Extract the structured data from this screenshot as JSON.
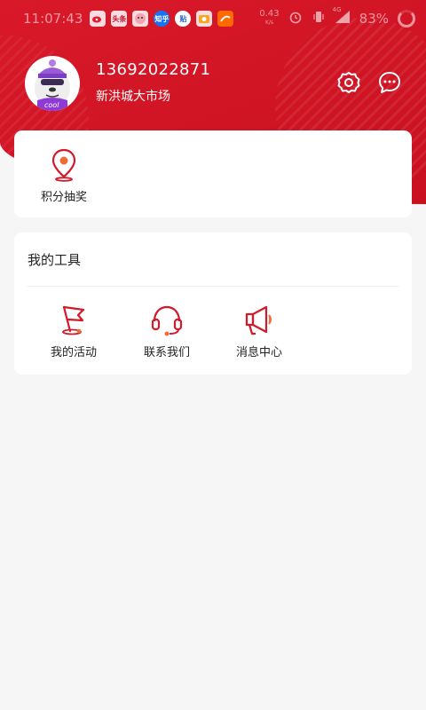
{
  "status_bar": {
    "time": "11:07:43",
    "apps": [
      "weibo-app",
      "toutiao-app",
      "comic-app",
      "zhihu-app",
      "tieba-app",
      "video-app",
      "store-app"
    ],
    "app_labels": [
      "",
      "头条",
      "",
      "知乎",
      "贴",
      "",
      ""
    ],
    "network_speed": "0.43",
    "network_unit": "K/s",
    "signal_label": "4G",
    "battery_percent": "83%"
  },
  "profile": {
    "avatar_label": "cool",
    "phone": "13692022871",
    "market_name": "新洪城大市场"
  },
  "header_actions": {
    "settings_icon": "gear-icon",
    "message_icon": "chat-bubble-icon"
  },
  "lottery_card": {
    "label": "积分抽奖",
    "icon": "location-pin-icon"
  },
  "tools": {
    "title": "我的工具",
    "items": [
      {
        "label": "我的活动",
        "icon": "flag-icon"
      },
      {
        "label": "联系我们",
        "icon": "headset-icon"
      },
      {
        "label": "消息中心",
        "icon": "megaphone-icon"
      }
    ]
  },
  "colors": {
    "primary_red": "#d11a2a",
    "accent_orange": "#f06a3a",
    "background": "#f6f6f6"
  }
}
